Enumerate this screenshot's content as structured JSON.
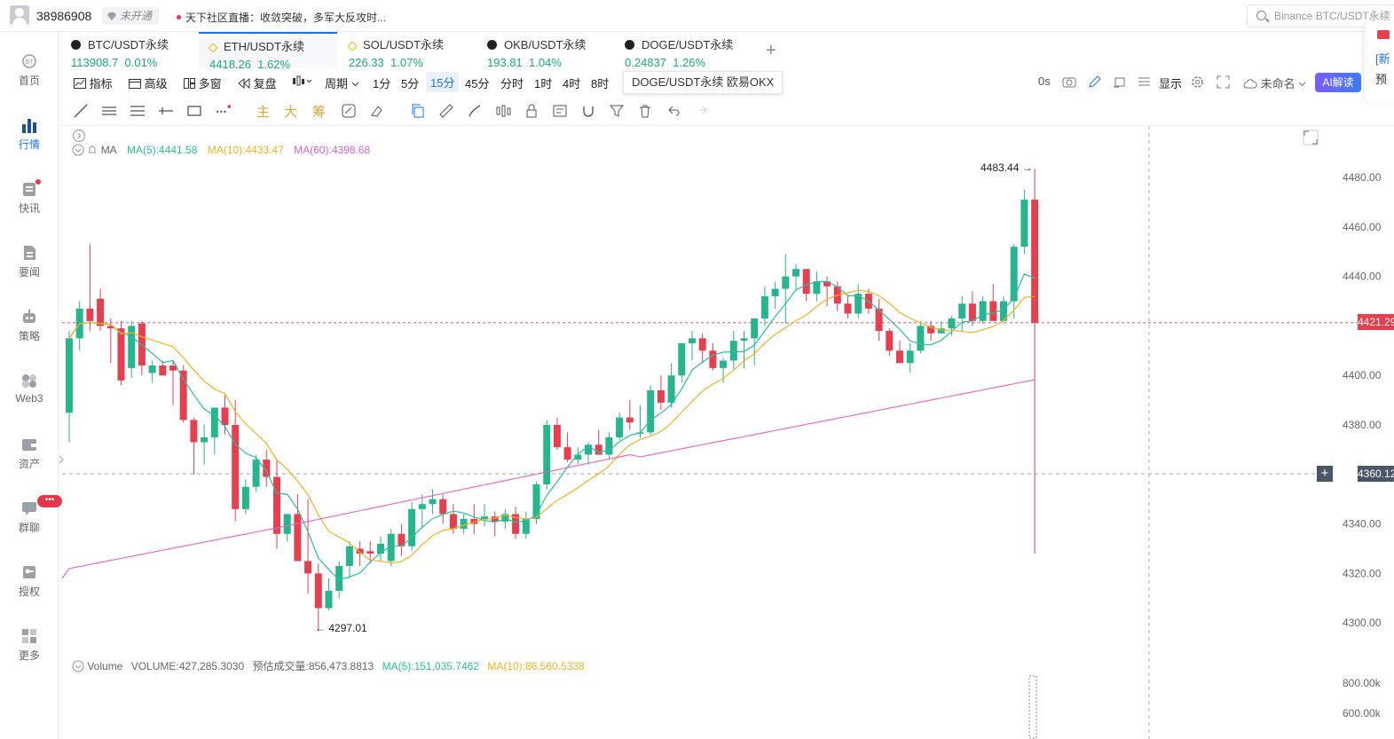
{
  "topbar": {
    "user_id": "38986908",
    "vip_label": "未开通",
    "news_ticker": "天下社区直播：收敛突破，多军大反攻时...",
    "search_placeholder": "Binance BTC/USDT永续"
  },
  "sidebar": {
    "items": [
      {
        "label": "首页",
        "icon": "home-icon"
      },
      {
        "label": "行情",
        "icon": "market-icon",
        "active": true
      },
      {
        "label": "快讯",
        "icon": "flash-news-icon",
        "dot": true
      },
      {
        "label": "要闻",
        "icon": "headlines-icon"
      },
      {
        "label": "策略",
        "icon": "strategy-icon"
      },
      {
        "label": "Web3",
        "icon": "web3-icon"
      },
      {
        "label": "资产",
        "icon": "wallet-icon"
      },
      {
        "label": "群聊",
        "icon": "chat-icon",
        "badge": "•••"
      },
      {
        "label": "授权",
        "icon": "key-icon"
      },
      {
        "label": "更多",
        "icon": "grid-icon"
      }
    ]
  },
  "tabs": [
    {
      "name": "BTC/USDT永续",
      "price": "113908.7",
      "change": "0.01%"
    },
    {
      "name": "ETH/USDT永续",
      "price": "4418.26",
      "change": "1.62%",
      "active": true
    },
    {
      "name": "SOL/USDT永续",
      "price": "226.33",
      "change": "1.07%"
    },
    {
      "name": "OKB/USDT永续",
      "price": "193.81",
      "change": "1.04%"
    },
    {
      "name": "DOGE/USDT永续",
      "price": "0.24837",
      "change": "1.26%"
    }
  ],
  "toolbar": {
    "indicators": "指标",
    "advanced": "高级",
    "multi_window": "多窗",
    "replay": "复盘",
    "period": "周期",
    "intervals": [
      "1分",
      "5分",
      "15分",
      "45分",
      "分时",
      "1时",
      "4时",
      "8时"
    ],
    "selected_interval": "15分",
    "countdown": "0s",
    "display": "显示",
    "unnamed": "未命名",
    "ai_button": "AI解读",
    "tooltip": "DOGE/USDT永续 欧易OKX"
  },
  "drawbar": {
    "labels": [
      "主",
      "大",
      "筹"
    ]
  },
  "legend": {
    "indicator": "MA",
    "ma5": "MA(5):4441.58",
    "ma10": "MA(10):4433.47",
    "ma60": "MA(60):4398.68"
  },
  "volume_legend": {
    "title": "Volume",
    "volume": "VOLUME:427,285.3030",
    "estimated": "预估成交量:856,473.8813",
    "ma5": "MA(5):151,035.7462",
    "ma10": "MA(10):86,560.5338"
  },
  "price_axis": [
    "4480.00",
    "4460.00",
    "4440.00",
    "4400.00",
    "4380.00",
    "4340.00",
    "4320.00",
    "4300.00"
  ],
  "volume_axis": [
    "800.00k",
    "600.00k"
  ],
  "current_price": "4421.29",
  "crosshair_price": "4360.12",
  "high_label": "4483.44",
  "low_label": "4297.01",
  "colors": {
    "up": "#26b58e",
    "down": "#e5404f",
    "ma5": "#2bbfa0",
    "ma10": "#f3b31f",
    "ma60": "#e062c9",
    "accent": "#1a73e8"
  },
  "chart_data": {
    "type": "candlestick",
    "symbol": "ETH/USDT永续",
    "interval": "15分",
    "ylim": [
      4290,
      4490
    ],
    "candles": [
      [
        4385,
        4418,
        4373,
        4415
      ],
      [
        4415,
        4430,
        4410,
        4427
      ],
      [
        4427,
        4453,
        4418,
        4422
      ],
      [
        4431,
        4435,
        4418,
        4420
      ],
      [
        4420,
        4423,
        4405,
        4419
      ],
      [
        4419,
        4422,
        4396,
        4398
      ],
      [
        4403,
        4422,
        4399,
        4420
      ],
      [
        4421,
        4422,
        4400,
        4404
      ],
      [
        4401,
        4406,
        4397,
        4404
      ],
      [
        4404,
        4406,
        4402,
        4400
      ],
      [
        4404,
        4406,
        4388,
        4402
      ],
      [
        4402,
        4404,
        4381,
        4382
      ],
      [
        4382,
        4383,
        4360,
        4373
      ],
      [
        4373,
        4380,
        4364,
        4375
      ],
      [
        4375,
        4387,
        4368,
        4387
      ],
      [
        4387,
        4392,
        4376,
        4380
      ],
      [
        4380,
        4390,
        4341,
        4346
      ],
      [
        4346,
        4358,
        4344,
        4355
      ],
      [
        4355,
        4368,
        4353,
        4366
      ],
      [
        4366,
        4370,
        4355,
        4359
      ],
      [
        4359,
        4366,
        4330,
        4336
      ],
      [
        4336,
        4344,
        4333,
        4344
      ],
      [
        4344,
        4352,
        4335,
        4325
      ],
      [
        4325,
        4350,
        4312,
        4320
      ],
      [
        4320,
        4324,
        4297,
        4306
      ],
      [
        4306,
        4318,
        4305,
        4313
      ],
      [
        4313,
        4325,
        4310,
        4323
      ],
      [
        4323,
        4333,
        4318,
        4331
      ],
      [
        4330,
        4333,
        4323,
        4328
      ],
      [
        4329,
        4333,
        4324,
        4328
      ],
      [
        4328,
        4335,
        4325,
        4332
      ],
      [
        4325,
        4338,
        4323,
        4336
      ],
      [
        4336,
        4340,
        4327,
        4331
      ],
      [
        4331,
        4349,
        4329,
        4346
      ],
      [
        4346,
        4352,
        4339,
        4348
      ],
      [
        4348,
        4354,
        4344,
        4350
      ],
      [
        4350,
        4352,
        4340,
        4344
      ],
      [
        4344,
        4348,
        4336,
        4338
      ],
      [
        4338,
        4344,
        4336,
        4342
      ],
      [
        4342,
        4348,
        4336,
        4340
      ],
      [
        4342,
        4348,
        4339,
        4343
      ],
      [
        4343,
        4345,
        4335,
        4341
      ],
      [
        4341,
        4346,
        4338,
        4344
      ],
      [
        4344,
        4347,
        4334,
        4336
      ],
      [
        4336,
        4345,
        4334,
        4342
      ],
      [
        4342,
        4357,
        4340,
        4356
      ],
      [
        4356,
        4382,
        4354,
        4380
      ],
      [
        4380,
        4383,
        4370,
        4371
      ],
      [
        4371,
        4377,
        4365,
        4366
      ],
      [
        4366,
        4371,
        4364,
        4368
      ],
      [
        4368,
        4373,
        4364,
        4372
      ],
      [
        4372,
        4378,
        4370,
        4368
      ],
      [
        4368,
        4377,
        4366,
        4375
      ],
      [
        4375,
        4385,
        4374,
        4383
      ],
      [
        4383,
        4390,
        4378,
        4381
      ],
      [
        4377,
        4388,
        4375,
        4377
      ],
      [
        4377,
        4396,
        4376,
        4394
      ],
      [
        4394,
        4400,
        4386,
        4389
      ],
      [
        4389,
        4405,
        4387,
        4400
      ],
      [
        4400,
        4410,
        4397,
        4413
      ],
      [
        4413,
        4418,
        4406,
        4415
      ],
      [
        4415,
        4417,
        4405,
        4410
      ],
      [
        4410,
        4413,
        4402,
        4403
      ],
      [
        4403,
        4407,
        4397,
        4406
      ],
      [
        4406,
        4418,
        4402,
        4414
      ],
      [
        4414,
        4418,
        4403,
        4415
      ],
      [
        4415,
        4420,
        4404,
        4423
      ],
      [
        4423,
        4436,
        4420,
        4432
      ],
      [
        4432,
        4438,
        4427,
        4435
      ],
      [
        4435,
        4449,
        4421,
        4440
      ],
      [
        4440,
        4445,
        4434,
        4443
      ],
      [
        4443,
        4442,
        4430,
        4433
      ],
      [
        4433,
        4442,
        4430,
        4438
      ],
      [
        4438,
        4440,
        4428,
        4436
      ],
      [
        4436,
        4438,
        4426,
        4429
      ],
      [
        4429,
        4432,
        4423,
        4425
      ],
      [
        4425,
        4437,
        4423,
        4433
      ],
      [
        4433,
        4435,
        4425,
        4427
      ],
      [
        4427,
        4431,
        4414,
        4418
      ],
      [
        4418,
        4419,
        4408,
        4410
      ],
      [
        4410,
        4414,
        4405,
        4405
      ],
      [
        4405,
        4413,
        4401,
        4410
      ],
      [
        4410,
        4422,
        4409,
        4420
      ],
      [
        4420,
        4422,
        4414,
        4417
      ],
      [
        4417,
        4422,
        4417,
        4419
      ],
      [
        4419,
        4424,
        4416,
        4423
      ],
      [
        4423,
        4432,
        4418,
        4429
      ],
      [
        4429,
        4434,
        4420,
        4422
      ],
      [
        4422,
        4432,
        4421,
        4430
      ],
      [
        4430,
        4437,
        4426,
        4422
      ],
      [
        4422,
        4432,
        4421,
        4430
      ],
      [
        4430,
        4453,
        4423,
        4452
      ],
      [
        4452,
        4475,
        4449,
        4471
      ],
      [
        4471,
        4483.44,
        4328,
        4421.29
      ]
    ]
  }
}
